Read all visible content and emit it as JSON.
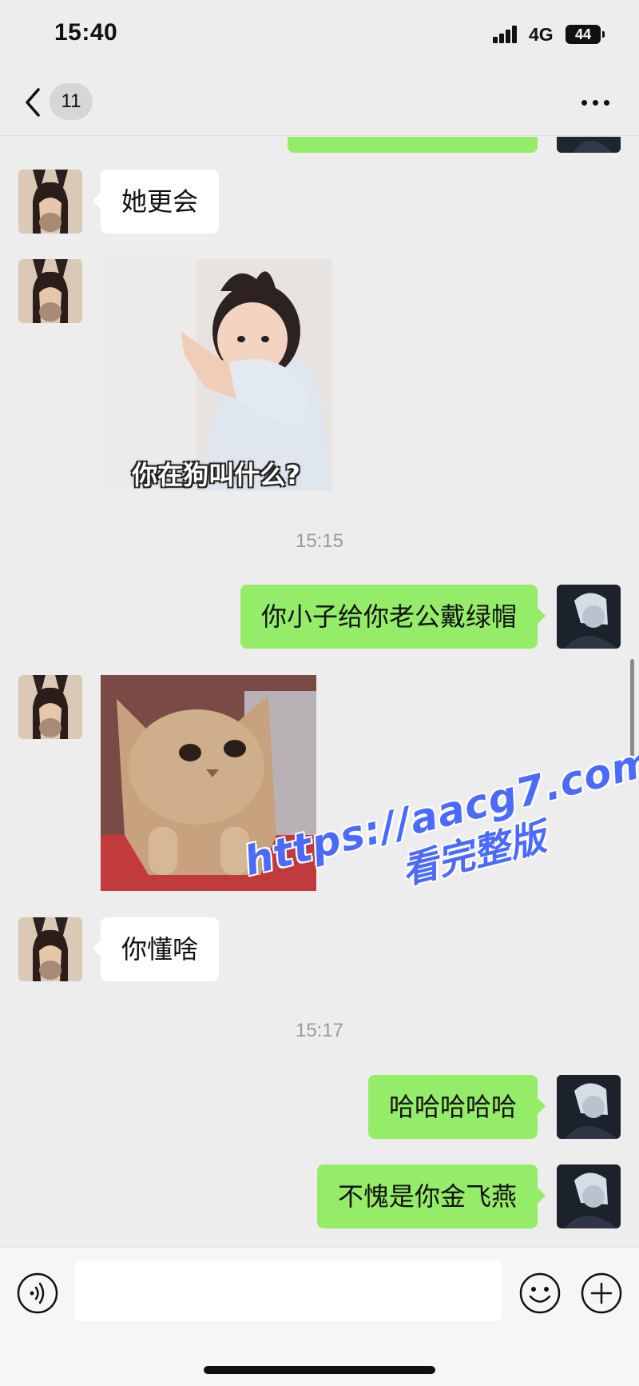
{
  "status_bar": {
    "time": "15:40",
    "network": "4G",
    "battery": "44"
  },
  "nav": {
    "unread_count": "11"
  },
  "messages": [
    {
      "direction": "in",
      "type": "text",
      "text": "她更会"
    },
    {
      "direction": "in",
      "type": "sticker",
      "sticker": "baby-pointing",
      "caption": "你在狗叫什么?"
    },
    {
      "type": "timestamp",
      "text": "15:15"
    },
    {
      "direction": "out",
      "type": "text",
      "text": "你小子给你老公戴绿帽"
    },
    {
      "direction": "in",
      "type": "sticker",
      "sticker": "cat-staring"
    },
    {
      "direction": "in",
      "type": "text",
      "text": "你懂啥"
    },
    {
      "type": "timestamp",
      "text": "15:17"
    },
    {
      "direction": "out",
      "type": "text",
      "text": "哈哈哈哈哈"
    },
    {
      "direction": "out",
      "type": "text",
      "text": "不愧是你金飞燕"
    }
  ],
  "watermark": {
    "url": "https://aacg7.com",
    "subtitle": "看完整版"
  },
  "input": {
    "value": "",
    "placeholder": ""
  },
  "icons": {
    "back": "chevron-left-icon",
    "more": "more-dots-icon",
    "voice": "voice-icon",
    "emoji": "emoji-icon",
    "plus": "plus-icon"
  },
  "colors": {
    "background": "#ededed",
    "outgoing_bubble": "#95ec69",
    "incoming_bubble": "#ffffff",
    "watermark": "#4b6bff",
    "timestamp": "#9a9a9a"
  }
}
